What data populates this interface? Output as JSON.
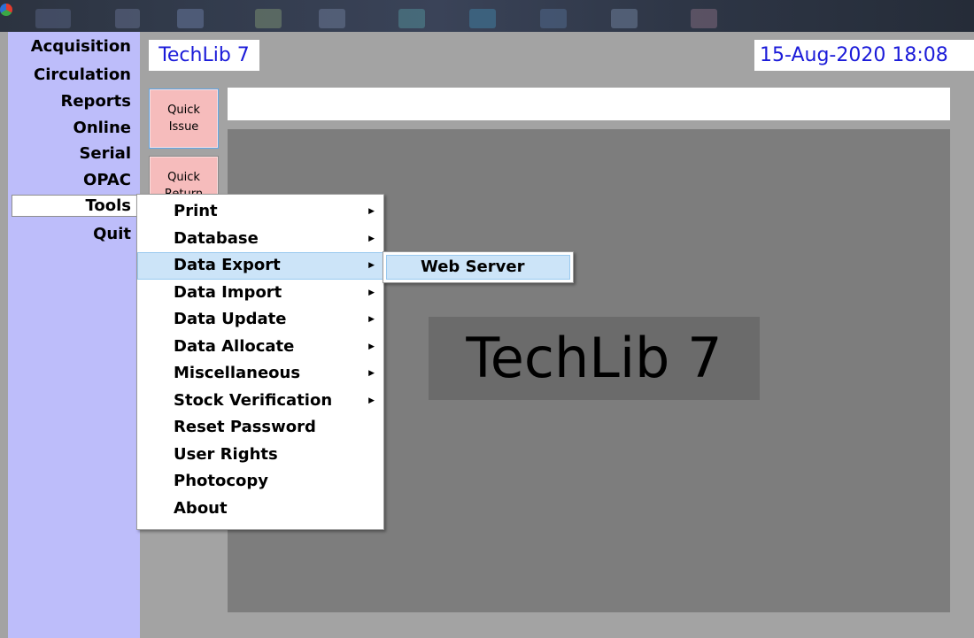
{
  "app": {
    "title": "TechLib 7",
    "datetime": "15-Aug-2020 18:08",
    "splash_text": "TechLib 7"
  },
  "taskbar": {
    "icons": [
      "app-logo-icon"
    ]
  },
  "nav": {
    "items": [
      {
        "label": "Acquisition"
      },
      {
        "label": "Circulation"
      },
      {
        "label": "Reports"
      },
      {
        "label": "Online"
      },
      {
        "label": "Serial"
      },
      {
        "label": "OPAC"
      },
      {
        "label": "Tools",
        "selected": true
      },
      {
        "label": "Quit"
      }
    ]
  },
  "quick": {
    "issue_label": "Quick Issue",
    "return_label": "Quick Return"
  },
  "search": {
    "value": "",
    "placeholder": ""
  },
  "tools_menu": {
    "items": [
      {
        "label": "Print",
        "has_submenu": true
      },
      {
        "label": "Database",
        "has_submenu": true
      },
      {
        "label": "Data Export",
        "has_submenu": true,
        "highlighted": true
      },
      {
        "label": "Data Import",
        "has_submenu": true
      },
      {
        "label": "Data Update",
        "has_submenu": true
      },
      {
        "label": "Data Allocate",
        "has_submenu": true
      },
      {
        "label": "Miscellaneous",
        "has_submenu": true
      },
      {
        "label": "Stock Verification",
        "has_submenu": true
      },
      {
        "label": "Reset Password",
        "has_submenu": false
      },
      {
        "label": "User Rights",
        "has_submenu": false
      },
      {
        "label": "Photocopy",
        "has_submenu": false
      },
      {
        "label": "About",
        "has_submenu": false
      }
    ],
    "submenu_arrow_icon": "submenu-arrow-icon"
  },
  "export_submenu": {
    "items": [
      {
        "label": "Web Server",
        "highlighted": true
      }
    ]
  },
  "colors": {
    "nav_bg": "#bdbdfa",
    "title_text": "#1b1bd9",
    "quick_btn_bg": "#f6bcbc",
    "highlight": "#cce4f8",
    "panel_bg": "#7d7d7d"
  }
}
